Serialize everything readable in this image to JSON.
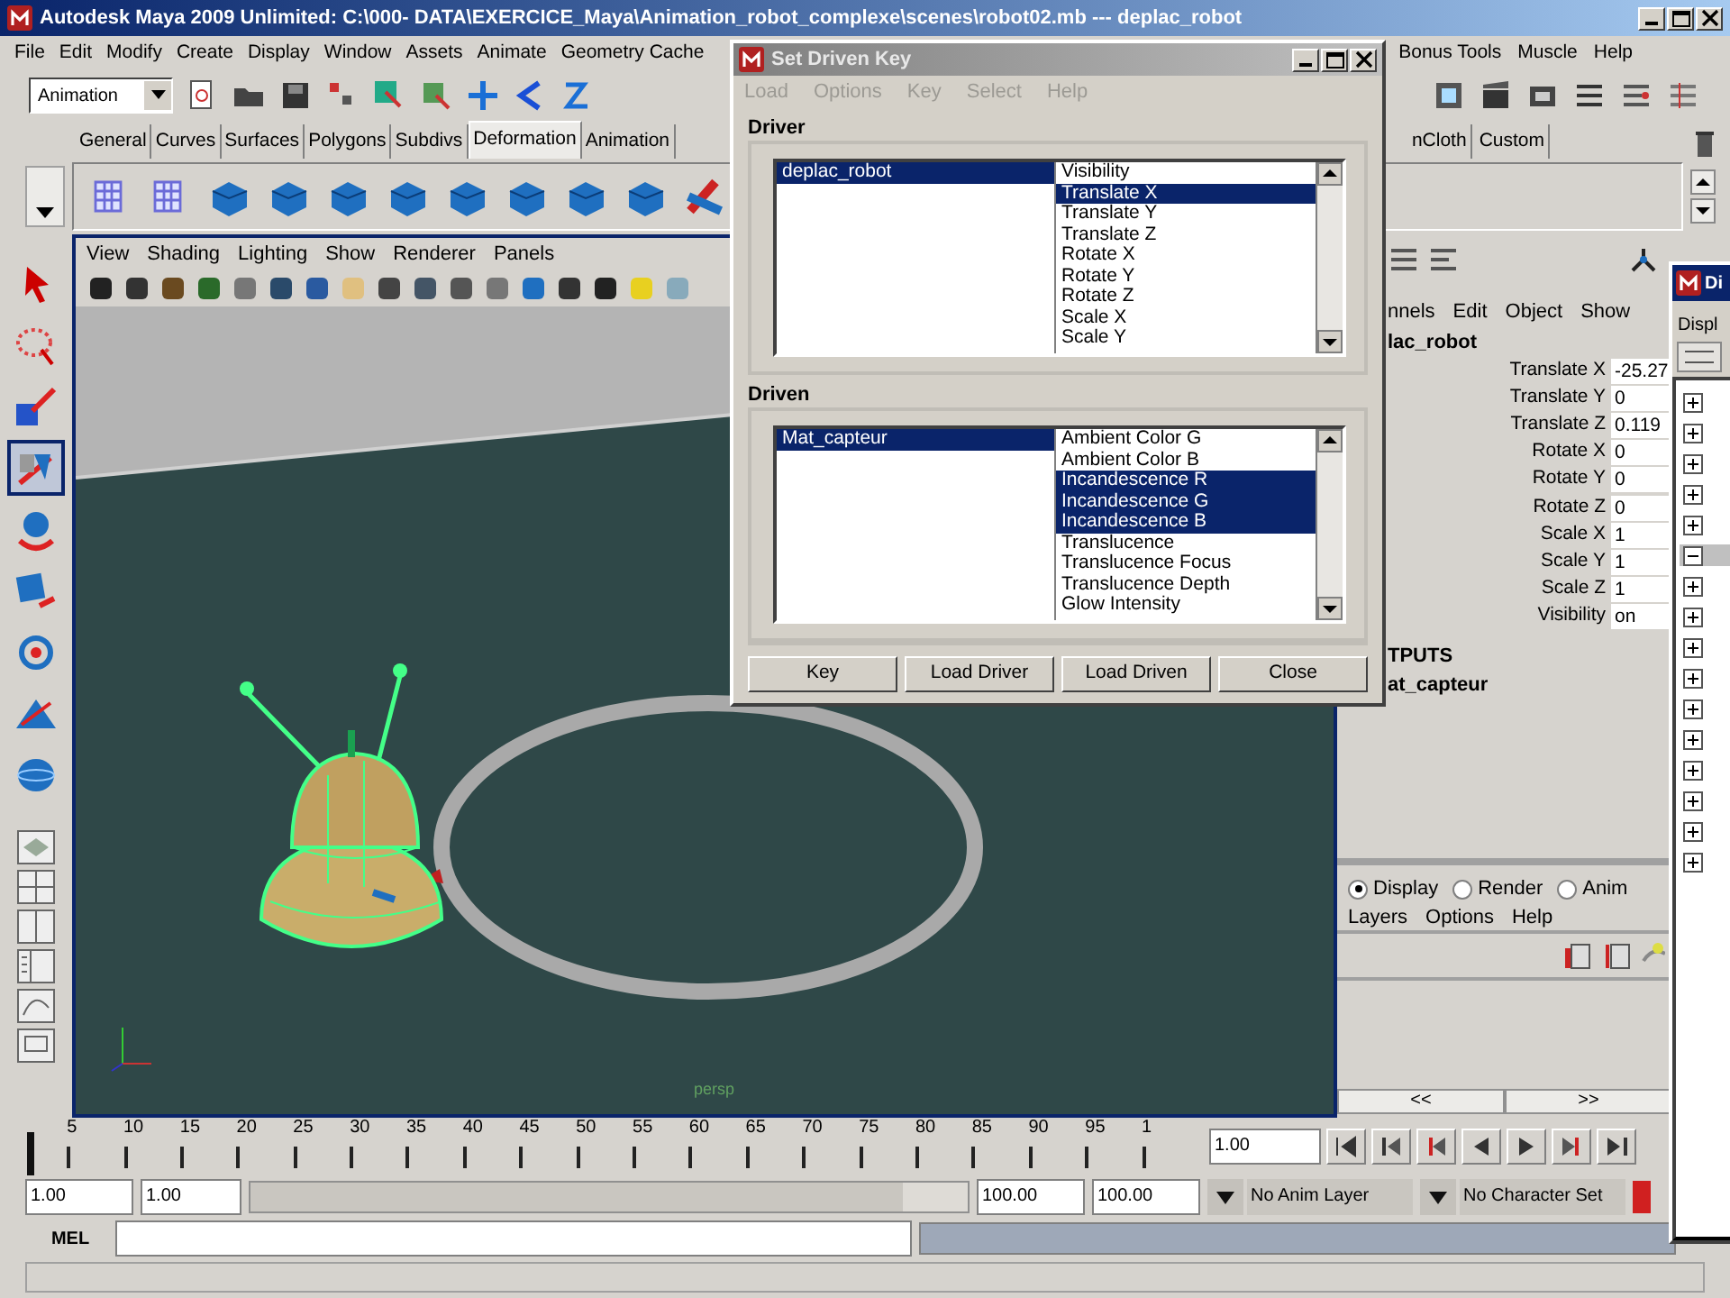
{
  "window": {
    "title": "Autodesk Maya 2009 Unlimited: C:\\000- DATA\\EXERCICE_Maya\\Animation_robot_complexe\\scenes\\robot02.mb --- deplac_robot"
  },
  "menu_bar": {
    "left": [
      "File",
      "Edit",
      "Modify",
      "Create",
      "Display",
      "Window",
      "Assets",
      "Animate",
      "Geometry Cache"
    ],
    "right": [
      "Bonus Tools",
      "Muscle",
      "Help"
    ]
  },
  "status_line": {
    "menu_set": "Animation"
  },
  "shelf": {
    "tabs": [
      {
        "label": "General",
        "selected": false
      },
      {
        "label": "Curves",
        "selected": false
      },
      {
        "label": "Surfaces",
        "selected": false
      },
      {
        "label": "Polygons",
        "selected": false
      },
      {
        "label": "Subdivs",
        "selected": false
      },
      {
        "label": "Deformation",
        "selected": true
      },
      {
        "label": "Animation",
        "selected": false
      }
    ],
    "tabs_right": [
      {
        "label": "nCloth",
        "selected": false
      },
      {
        "label": "Custom",
        "selected": false
      }
    ]
  },
  "toolbox": {
    "tools": [
      {
        "selected": false
      },
      {
        "selected": false
      },
      {
        "selected": false
      },
      {
        "selected": true
      },
      {
        "selected": false
      },
      {
        "selected": false
      },
      {
        "selected": false
      },
      {
        "selected": false
      },
      {
        "selected": false
      }
    ]
  },
  "viewport": {
    "menus": [
      "View",
      "Shading",
      "Lighting",
      "Show",
      "Renderer",
      "Panels"
    ],
    "camera_label": "persp"
  },
  "channel_box": {
    "menus": [
      "nnels",
      "Edit",
      "Object",
      "Show"
    ],
    "object": "lac_robot",
    "channels": [
      {
        "name": "Translate X",
        "value": "-25.27"
      },
      {
        "name": "Translate Y",
        "value": "0"
      },
      {
        "name": "Translate Z",
        "value": "0.119"
      },
      {
        "name": "Rotate X",
        "value": "0"
      },
      {
        "name": "Rotate Y",
        "value": "0"
      },
      {
        "name": "Rotate Z",
        "value": "0"
      },
      {
        "name": "Scale X",
        "value": "1"
      },
      {
        "name": "Scale Y",
        "value": "1"
      },
      {
        "name": "Scale Z",
        "value": "1"
      },
      {
        "name": "Visibility",
        "value": "on"
      }
    ],
    "outputs_heading": "TPUTS",
    "output": "at_capteur"
  },
  "layer_editor": {
    "modes": [
      {
        "label": "Display",
        "selected": true
      },
      {
        "label": "Render",
        "selected": false
      },
      {
        "label": "Anim",
        "selected": false
      }
    ],
    "menus": [
      "Layers",
      "Options",
      "Help"
    ],
    "scroll": [
      "<<",
      ">>"
    ]
  },
  "outliner": {
    "title": "Di",
    "menu": "Displ",
    "rows": [
      {
        "expanded": false,
        "selected": false
      },
      {
        "expanded": false,
        "selected": false
      },
      {
        "expanded": false,
        "selected": false
      },
      {
        "expanded": false,
        "selected": false
      },
      {
        "expanded": false,
        "selected": false
      },
      {
        "expanded": true,
        "selected": true
      },
      {
        "expanded": false,
        "selected": false
      },
      {
        "expanded": false,
        "selected": false
      },
      {
        "expanded": false,
        "selected": false
      },
      {
        "expanded": false,
        "selected": false
      },
      {
        "expanded": false,
        "selected": false
      },
      {
        "expanded": false,
        "selected": false
      },
      {
        "expanded": false,
        "selected": false
      },
      {
        "expanded": false,
        "selected": false
      },
      {
        "expanded": false,
        "selected": false
      },
      {
        "expanded": false,
        "selected": false
      }
    ]
  },
  "dialog": {
    "title": "Set Driven Key",
    "menus": [
      "Load",
      "Options",
      "Key",
      "Select",
      "Help"
    ],
    "driver": {
      "label": "Driver",
      "objects": [
        {
          "label": "deplac_robot",
          "selected": true
        }
      ],
      "attributes": [
        {
          "label": "Visibility",
          "selected": false
        },
        {
          "label": "Translate X",
          "selected": true
        },
        {
          "label": "Translate Y",
          "selected": false
        },
        {
          "label": "Translate Z",
          "selected": false
        },
        {
          "label": "Rotate X",
          "selected": false
        },
        {
          "label": "Rotate Y",
          "selected": false
        },
        {
          "label": "Rotate Z",
          "selected": false
        },
        {
          "label": "Scale X",
          "selected": false
        },
        {
          "label": "Scale Y",
          "selected": false
        }
      ]
    },
    "driven": {
      "label": "Driven",
      "objects": [
        {
          "label": "Mat_capteur",
          "selected": true
        }
      ],
      "attributes": [
        {
          "label": "Ambient Color G",
          "selected": false
        },
        {
          "label": "Ambient Color B",
          "selected": false
        },
        {
          "label": "Incandescence R",
          "selected": true
        },
        {
          "label": "Incandescence G",
          "selected": true
        },
        {
          "label": "Incandescence B",
          "selected": true
        },
        {
          "label": "Translucence",
          "selected": false
        },
        {
          "label": "Translucence Focus",
          "selected": false
        },
        {
          "label": "Translucence Depth",
          "selected": false
        },
        {
          "label": "Glow Intensity",
          "selected": false
        }
      ]
    },
    "buttons": [
      "Key",
      "Load Driver",
      "Load Driven",
      "Close"
    ]
  },
  "timeline": {
    "ticks": [
      "5",
      "10",
      "15",
      "20",
      "25",
      "30",
      "35",
      "40",
      "45",
      "50",
      "55",
      "60",
      "65",
      "70",
      "75",
      "80",
      "85",
      "90",
      "95",
      "1"
    ],
    "current_frame": "1.00"
  },
  "range_slider": {
    "start": "1.00",
    "playback_start": "1.00",
    "playback_end": "100.00",
    "end": "100.00",
    "level": 1,
    "anim_layer": "No Anim Layer",
    "character_set": "No Character Set"
  },
  "command_line": {
    "language": "MEL"
  }
}
